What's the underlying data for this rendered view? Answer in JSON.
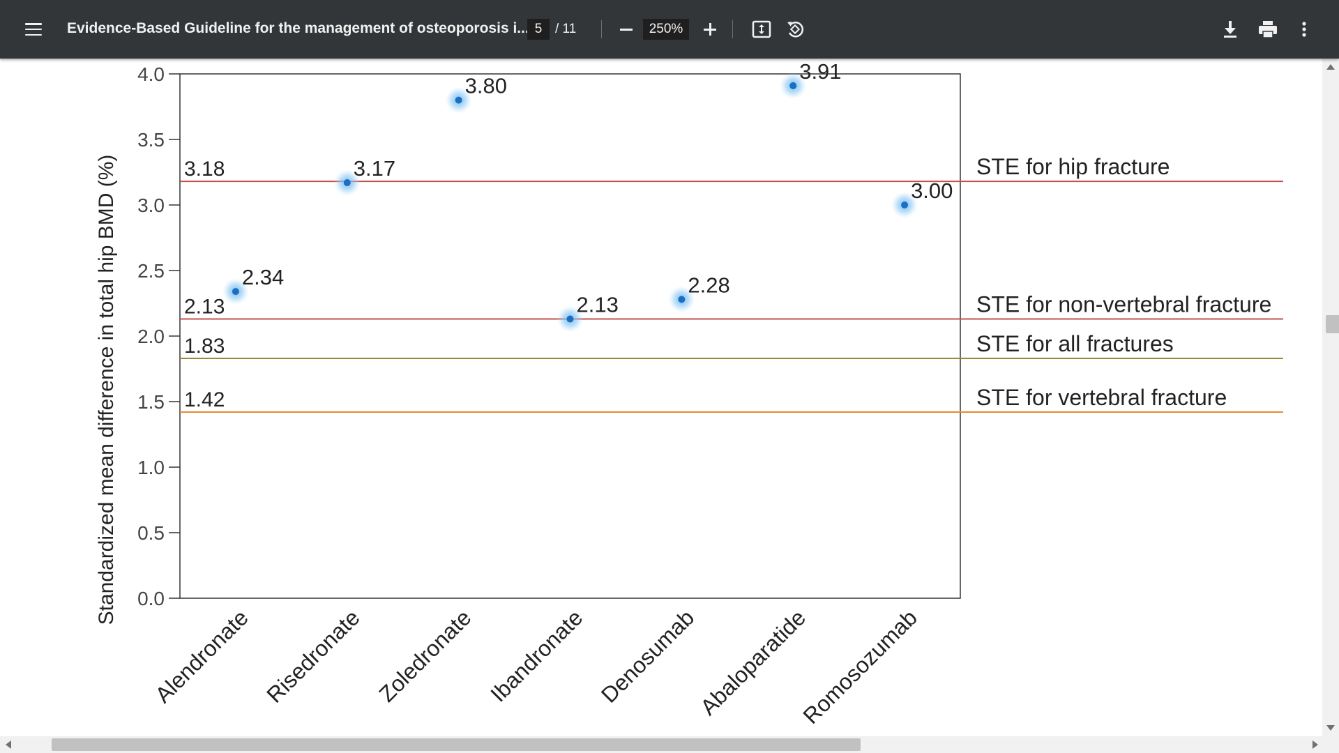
{
  "toolbar": {
    "title": "Evidence-Based Guideline for the management of osteoporosis i...",
    "page_current": "5",
    "page_total": "/ 11",
    "zoom": "250%"
  },
  "colors": {
    "toolbar_bg": "#323639",
    "hip_line": "#c0504d",
    "nonvert_line": "#c0504d",
    "all_line": "#9a8a3a",
    "vert_line": "#e8892f",
    "point": "#1a6fc4",
    "point_glow": "#6ab7f0"
  },
  "chart_data": {
    "type": "scatter",
    "title": "",
    "xlabel": "",
    "ylabel": "Standardized mean difference in total hip BMD (%)",
    "ylim": [
      0,
      4
    ],
    "yticks": [
      "0.0",
      "0.5",
      "1.0",
      "1.5",
      "2.0",
      "2.5",
      "3.0",
      "3.5",
      "4.0"
    ],
    "categories": [
      "Alendronate",
      "Risedronate",
      "Zoledronate",
      "Ibandronate",
      "Denosumab",
      "Abaloparatide",
      "Romosozumab"
    ],
    "values": [
      2.34,
      3.17,
      3.8,
      2.13,
      2.28,
      3.91,
      3.0
    ],
    "value_labels": [
      "2.34",
      "3.17",
      "3.80",
      "2.13",
      "2.28",
      "3.91",
      "3.00"
    ],
    "reference_lines": [
      {
        "value": 3.18,
        "label": "3.18",
        "name": "STE for hip fracture",
        "color": "#c0504d"
      },
      {
        "value": 2.13,
        "label": "2.13",
        "name": "STE for non-vertebral fracture",
        "color": "#c0504d"
      },
      {
        "value": 1.83,
        "label": "1.83",
        "name": "STE for all fractures",
        "color": "#9a8a3a"
      },
      {
        "value": 1.42,
        "label": "1.42",
        "name": "STE for vertebral fracture",
        "color": "#e8892f"
      }
    ],
    "grid": false
  }
}
